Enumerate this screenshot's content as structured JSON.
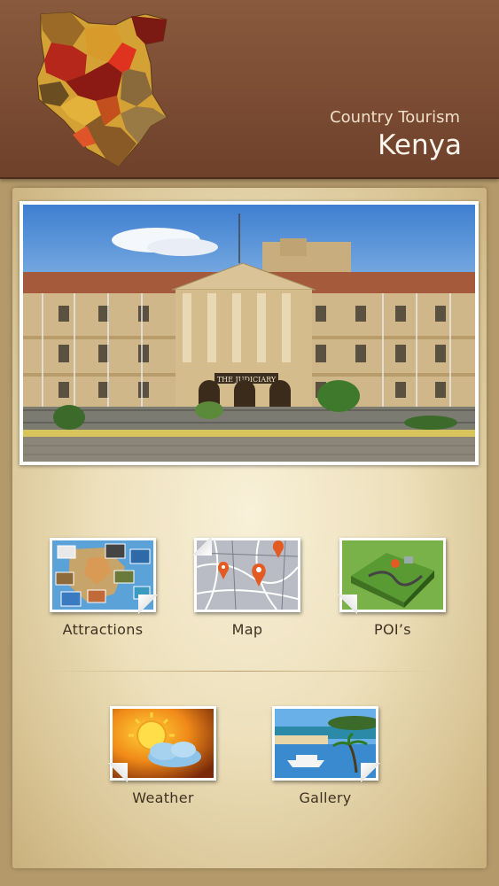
{
  "header": {
    "subtitle": "Country Tourism",
    "title": "Kenya",
    "logo_icon": "kenya-map-icon"
  },
  "hero": {
    "photo_sign": "THE JUDICIARY"
  },
  "menu": {
    "attractions": {
      "label": "Attractions",
      "icon": "attractions-collage-icon"
    },
    "map": {
      "label": "Map",
      "icon": "map-pins-icon"
    },
    "pois": {
      "label": "POI’s",
      "icon": "poi-terrain-icon"
    },
    "weather": {
      "label": "Weather",
      "icon": "weather-sun-cloud-icon"
    },
    "gallery": {
      "label": "Gallery",
      "icon": "gallery-photos-icon"
    }
  },
  "colors": {
    "header_brown": "#7a4a32",
    "panel_cream": "#ede0bb",
    "label_text": "#3e3222"
  }
}
